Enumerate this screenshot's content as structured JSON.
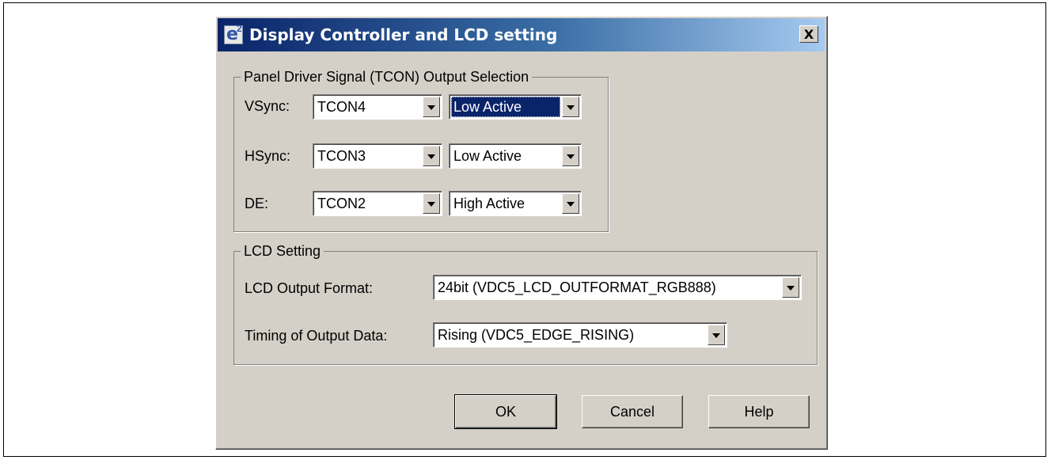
{
  "window": {
    "title": "Display Controller and LCD setting",
    "icon": "e2-studio-icon",
    "close_symbol": "X"
  },
  "tcon_group": {
    "legend": "Panel Driver Signal (TCON) Output Selection",
    "rows": [
      {
        "label": "VSync:",
        "tcon": "TCON4",
        "polarity": "Low Active"
      },
      {
        "label": "HSync:",
        "tcon": "TCON3",
        "polarity": "Low Active"
      },
      {
        "label": "DE:",
        "tcon": "TCON2",
        "polarity": "High Active"
      }
    ]
  },
  "lcd_group": {
    "legend": "LCD Setting",
    "output_format_label": "LCD Output Format:",
    "output_format_value": "24bit (VDC5_LCD_OUTFORMAT_RGB888)",
    "timing_label": "Timing of Output Data:",
    "timing_value": "Rising (VDC5_EDGE_RISING)"
  },
  "buttons": {
    "ok": "OK",
    "cancel": "Cancel",
    "help": "Help"
  },
  "colors": {
    "titlebar_start": "#0a246a",
    "titlebar_end": "#a6caf0",
    "dialog_bg": "#d4d0c8"
  }
}
